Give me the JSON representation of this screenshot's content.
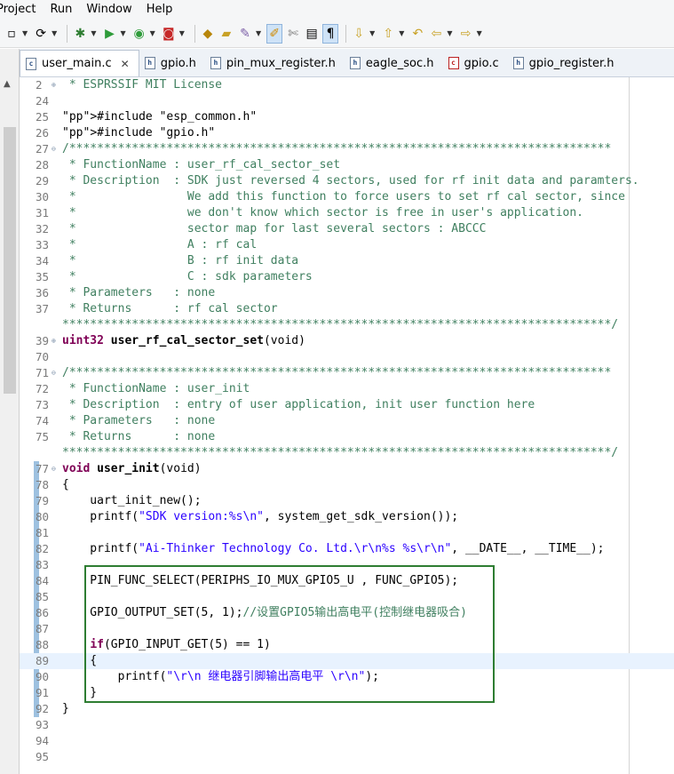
{
  "menu": [
    "Project",
    "Run",
    "Window",
    "Help"
  ],
  "tabs": [
    {
      "label": "user_main.c",
      "icon": "c-file-icon",
      "active": true
    },
    {
      "label": "gpio.h",
      "icon": "h-file-icon",
      "active": false
    },
    {
      "label": "pin_mux_register.h",
      "icon": "h-file-icon",
      "active": false
    },
    {
      "label": "eagle_soc.h",
      "icon": "h-file-icon",
      "active": false
    },
    {
      "label": "gpio.c",
      "icon": "c-file-icon",
      "active": false
    },
    {
      "label": "gpio_register.h",
      "icon": "h-file-icon",
      "active": false
    }
  ],
  "code_lines": [
    {
      "n": "2",
      "text": " * ESPRSSIF MIT License"
    },
    {
      "n": "24",
      "text": ""
    },
    {
      "n": "25",
      "text": "#include \"esp_common.h\""
    },
    {
      "n": "26",
      "text": "#include \"gpio.h\""
    },
    {
      "n": "27",
      "text": "/******************************************************************************"
    },
    {
      "n": "28",
      "text": " * FunctionName : user_rf_cal_sector_set"
    },
    {
      "n": "29",
      "text": " * Description  : SDK just reversed 4 sectors, used for rf init data and paramters."
    },
    {
      "n": "30",
      "text": " *                We add this function to force users to set rf cal sector, since"
    },
    {
      "n": "31",
      "text": " *                we don't know which sector is free in user's application."
    },
    {
      "n": "32",
      "text": " *                sector map for last several sectors : ABCCC"
    },
    {
      "n": "33",
      "text": " *                A : rf cal"
    },
    {
      "n": "34",
      "text": " *                B : rf init data"
    },
    {
      "n": "35",
      "text": " *                C : sdk parameters"
    },
    {
      "n": "36",
      "text": " * Parameters   : none"
    },
    {
      "n": "37",
      "text": " * Returns      : rf cal sector"
    },
    {
      "n": "",
      "text": "*******************************************************************************/"
    },
    {
      "n": "39",
      "text": "uint32 user_rf_cal_sector_set(void)"
    },
    {
      "n": "70",
      "text": ""
    },
    {
      "n": "71",
      "text": "/******************************************************************************"
    },
    {
      "n": "72",
      "text": " * FunctionName : user_init"
    },
    {
      "n": "73",
      "text": " * Description  : entry of user application, init user function here"
    },
    {
      "n": "74",
      "text": " * Parameters   : none"
    },
    {
      "n": "75",
      "text": " * Returns      : none"
    },
    {
      "n": "",
      "text": "*******************************************************************************/"
    },
    {
      "n": "77",
      "text": "void user_init(void)"
    },
    {
      "n": "78",
      "text": "{"
    },
    {
      "n": "79",
      "text": "    uart_init_new();"
    },
    {
      "n": "80",
      "text": "    printf(\"SDK version:%s\\n\", system_get_sdk_version());"
    },
    {
      "n": "81",
      "text": ""
    },
    {
      "n": "82",
      "text": "    printf(\"Ai-Thinker Technology Co. Ltd.\\r\\n%s %s\\r\\n\", __DATE__, __TIME__);"
    },
    {
      "n": "83",
      "text": ""
    },
    {
      "n": "84",
      "text": "    PIN_FUNC_SELECT(PERIPHS_IO_MUX_GPIO5_U , FUNC_GPIO5);"
    },
    {
      "n": "85",
      "text": ""
    },
    {
      "n": "86",
      "text": "    GPIO_OUTPUT_SET(5, 1);//设置GPIO5输出高电平(控制继电器吸合)"
    },
    {
      "n": "87",
      "text": ""
    },
    {
      "n": "88",
      "text": "    if(GPIO_INPUT_GET(5) == 1)"
    },
    {
      "n": "89",
      "text": "    {"
    },
    {
      "n": "90",
      "text": "        printf(\"\\r\\n 继电器引脚输出高电平 \\r\\n\");"
    },
    {
      "n": "91",
      "text": "    }"
    },
    {
      "n": "92",
      "text": "}"
    },
    {
      "n": "93",
      "text": ""
    },
    {
      "n": "94",
      "text": ""
    },
    {
      "n": "95",
      "text": ""
    }
  ],
  "colors": {
    "comment": "#3f7f5f",
    "keyword": "#7f0055",
    "string": "#2a00ff",
    "highlight_box": "#2e7d32",
    "current_line": "#e8f2fe"
  }
}
